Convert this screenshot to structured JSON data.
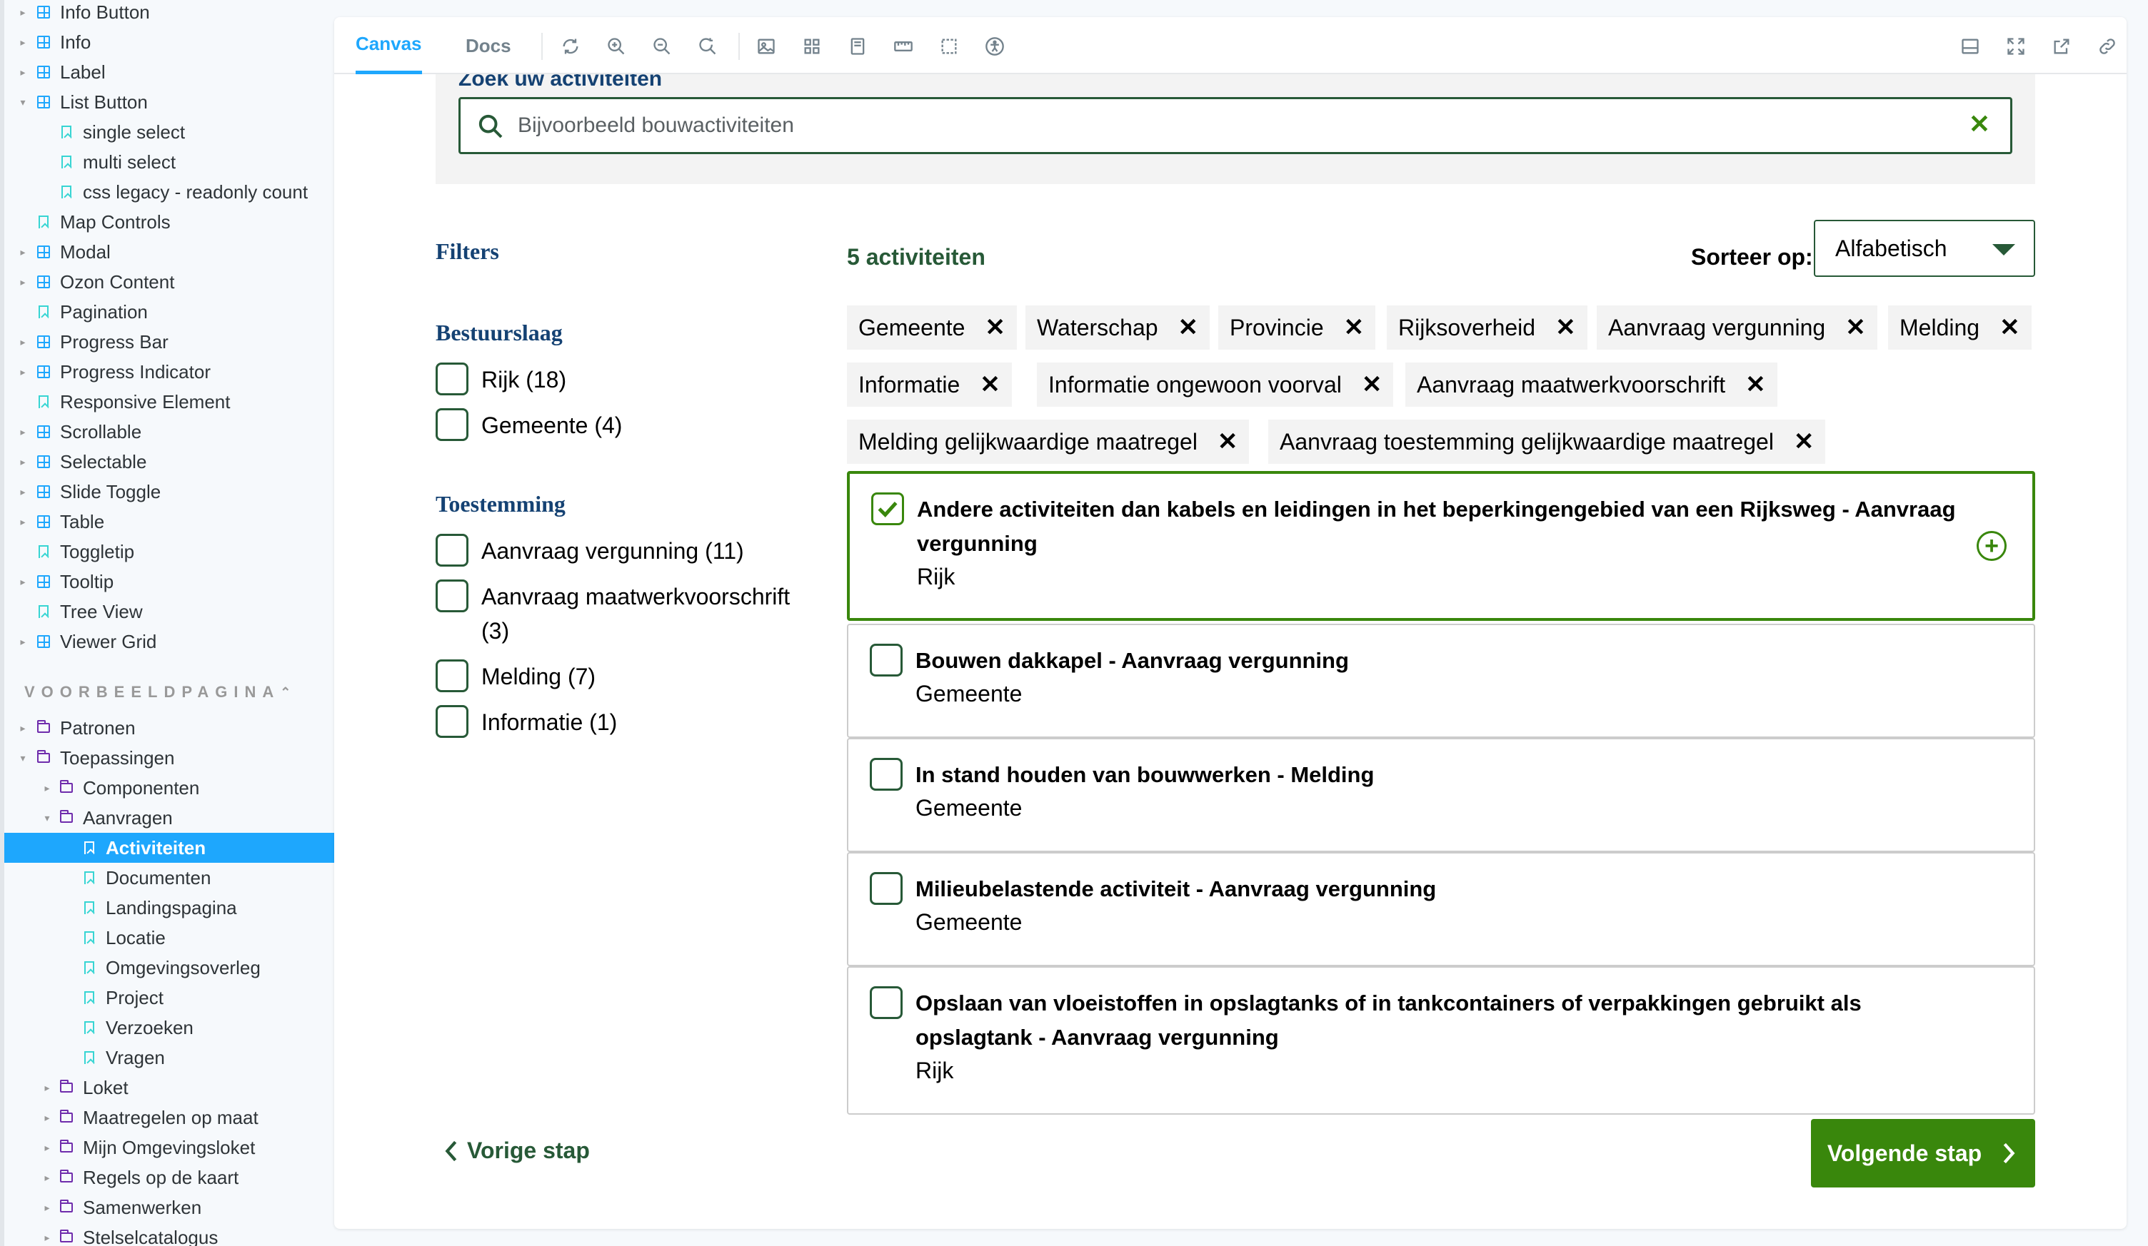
{
  "sidebar": {
    "items": [
      {
        "label": "Info Button",
        "type": "component"
      },
      {
        "label": "Info",
        "type": "component"
      },
      {
        "label": "Label",
        "type": "component"
      },
      {
        "label": "List Button",
        "type": "component"
      },
      {
        "label": "single select",
        "type": "story"
      },
      {
        "label": "multi select",
        "type": "story"
      },
      {
        "label": "css legacy - readonly count",
        "type": "story"
      },
      {
        "label": "Map Controls",
        "type": "story"
      },
      {
        "label": "Modal",
        "type": "component"
      },
      {
        "label": "Ozon Content",
        "type": "component"
      },
      {
        "label": "Pagination",
        "type": "story"
      },
      {
        "label": "Progress Bar",
        "type": "component"
      },
      {
        "label": "Progress Indicator",
        "type": "component"
      },
      {
        "label": "Responsive Element",
        "type": "story"
      },
      {
        "label": "Scrollable",
        "type": "component"
      },
      {
        "label": "Selectable",
        "type": "component"
      },
      {
        "label": "Slide Toggle",
        "type": "component"
      },
      {
        "label": "Table",
        "type": "component"
      },
      {
        "label": "Toggletip",
        "type": "story"
      },
      {
        "label": "Tooltip",
        "type": "component"
      },
      {
        "label": "Tree View",
        "type": "story"
      },
      {
        "label": "Viewer Grid",
        "type": "component"
      }
    ],
    "section_title": "VOORBEELDPAGINA",
    "section_items": [
      {
        "label": "Patronen",
        "type": "folder"
      },
      {
        "label": "Toepassingen",
        "type": "folder"
      },
      {
        "label": "Componenten",
        "type": "folder"
      },
      {
        "label": "Aanvragen",
        "type": "folder"
      },
      {
        "label": "Activiteiten",
        "type": "story",
        "selected": true
      },
      {
        "label": "Documenten",
        "type": "story"
      },
      {
        "label": "Landingspagina",
        "type": "story"
      },
      {
        "label": "Locatie",
        "type": "story"
      },
      {
        "label": "Omgevingsoverleg",
        "type": "story"
      },
      {
        "label": "Project",
        "type": "story"
      },
      {
        "label": "Verzoeken",
        "type": "story"
      },
      {
        "label": "Vragen",
        "type": "story"
      },
      {
        "label": "Loket",
        "type": "folder"
      },
      {
        "label": "Maatregelen op maat",
        "type": "folder"
      },
      {
        "label": "Mijn Omgevingsloket",
        "type": "folder"
      },
      {
        "label": "Regels op de kaart",
        "type": "folder"
      },
      {
        "label": "Samenwerken",
        "type": "folder"
      },
      {
        "label": "Stelselcatalogus",
        "type": "folder"
      }
    ]
  },
  "toolbar": {
    "tab_canvas": "Canvas",
    "tab_docs": "Docs"
  },
  "search": {
    "heading": "Zoek uw activiteiten",
    "placeholder": "Bijvoorbeeld bouwactiviteiten"
  },
  "filters": {
    "title": "Filters",
    "groups": [
      {
        "title": "Bestuurslaag",
        "options": [
          "Rijk (18)",
          "Gemeente (4)"
        ]
      },
      {
        "title": "Toestemming",
        "options": [
          "Aanvraag vergunning (11)",
          "Aanvraag maatwerkvoorschrift (3)",
          "Melding (7)",
          "Informatie (1)"
        ]
      }
    ]
  },
  "results": {
    "count": "5 activiteiten",
    "sort_label": "Sorteer op:",
    "sort_value": "Alfabetisch",
    "chips": [
      "Gemeente",
      "Waterschap",
      "Provincie",
      "Rijksoverheid",
      "Aanvraag vergunning",
      "Melding",
      "Informatie",
      "Informatie ongewoon voorval",
      "Aanvraag maatwerkvoorschrift",
      "Melding gelijkwaardige maatregel",
      "Aanvraag toestemming gelijkwaardige maatregel"
    ],
    "cards": [
      {
        "title": "Andere activiteiten dan kabels en leidingen in het beperkingengebied van een Rijksweg - Aanvraag vergunning",
        "authority": "Rijk",
        "checked": true
      },
      {
        "title": "Bouwen dakkapel - Aanvraag vergunning",
        "authority": "Gemeente",
        "checked": false
      },
      {
        "title": "In stand houden van bouwwerken - Melding",
        "authority": "Gemeente",
        "checked": false
      },
      {
        "title": "Milieubelastende activiteit - Aanvraag vergunning",
        "authority": "Gemeente",
        "checked": false
      },
      {
        "title": "Opslaan van vloeistoffen in opslagtanks of in tankcontainers of verpakkingen gebruikt als opslagtank - Aanvraag vergunning",
        "authority": "Rijk",
        "checked": false
      }
    ]
  },
  "nav": {
    "prev": "Vorige stap",
    "next": "Volgende stap"
  },
  "colors": {
    "accent_green": "#39870c",
    "dark_green": "#275937",
    "storybook_blue": "#1ea7fd"
  }
}
